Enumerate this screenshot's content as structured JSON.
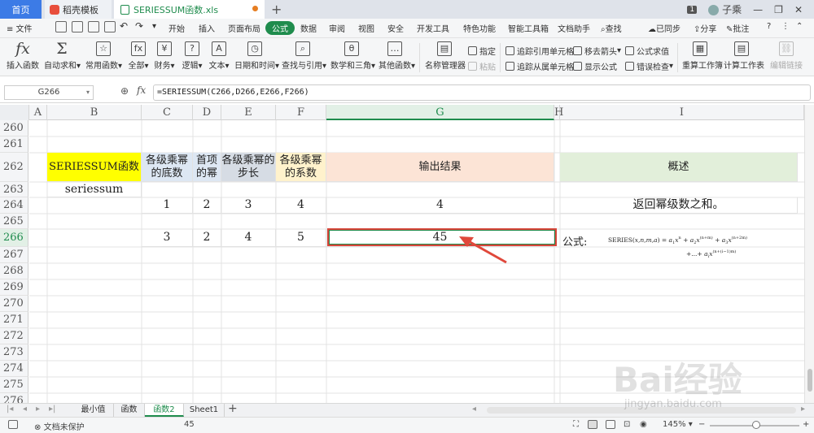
{
  "tabs": {
    "home": "首页",
    "daoke": "稻壳模板",
    "file": "SERIESSUM函数.xls",
    "plus": "+"
  },
  "window": {
    "badge": "1",
    "user": "子乘"
  },
  "menu": {
    "file": "≡ 文件",
    "items": [
      "开始",
      "插入",
      "页面布局",
      "公式",
      "数据",
      "审阅",
      "视图",
      "安全",
      "开发工具",
      "特色功能",
      "智能工具箱",
      "文档助手"
    ],
    "search": "查找",
    "sync": "已同步",
    "share": "分享",
    "comment": "批注"
  },
  "ribbon": {
    "insert_func": "插入函数",
    "autosum": "自动求和",
    "common": "常用函数",
    "all": "全部",
    "finance": "财务",
    "logic": "逻辑",
    "text": "文本",
    "datetime": "日期和时间",
    "lookup": "查找与引用",
    "math": "数学和三角",
    "other": "其他函数",
    "name_mgr": "名称管理器",
    "specify": "指定",
    "paste": "粘贴",
    "trace_prec": "追踪引用单元格",
    "trace_dep": "追踪从属单元格",
    "remove_arrows": "移去箭头",
    "show_formula": "显示公式",
    "eval_formula": "公式求值",
    "error_check": "错误检查",
    "recalc": "重算工作簿",
    "calc_sheet": "计算工作表",
    "edit_links": "编辑链接"
  },
  "formula_bar": {
    "name_box": "G266",
    "fx": "fx",
    "formula": "=SERIESSUM(C266,D266,E266,F266)"
  },
  "columns": [
    "A",
    "B",
    "C",
    "D",
    "E",
    "F",
    "G",
    "H",
    "I"
  ],
  "rows": [
    "260",
    "261",
    "262",
    "263",
    "264",
    "265",
    "266",
    "267",
    "268",
    "269",
    "270",
    "271",
    "272",
    "273",
    "274",
    "275",
    "276"
  ],
  "cells": {
    "B262": "SERIESSUM函数",
    "C262": "各级乘幂的底数",
    "D262": "首项的幂",
    "E262": "各级乘幂的步长",
    "F262": "各级乘幂的系数",
    "G262": "输出结果",
    "I262": "概述",
    "B263": "seriessum",
    "C264": "1",
    "D264": "2",
    "E264": "3",
    "F264": "4",
    "G264": "4",
    "I264": "返回幂级数之和。",
    "C266": "3",
    "D266": "2",
    "E266": "4",
    "F266": "5",
    "G266": "45",
    "I266": "公式:"
  },
  "colors": {
    "accent": "#1f8c4d",
    "b262_fill": "#ffff00",
    "c262_fill": "#dde7f3",
    "d262_fill": "#dde7f3",
    "e262_fill": "#d6dce4",
    "f262_fill": "#fff2cc",
    "g262_fill": "#fce4d6",
    "i262_fill": "#e2efda",
    "highlight": "#d8453a"
  },
  "sheets": [
    "最小值",
    "函数",
    "函数2",
    "Sheet1"
  ],
  "active_sheet": "函数2",
  "status": {
    "protect": "文档未保护",
    "value": "45",
    "zoom": "145%"
  },
  "watermark": {
    "brand": "Bai经验",
    "url": "jingyan.baidu.com"
  }
}
